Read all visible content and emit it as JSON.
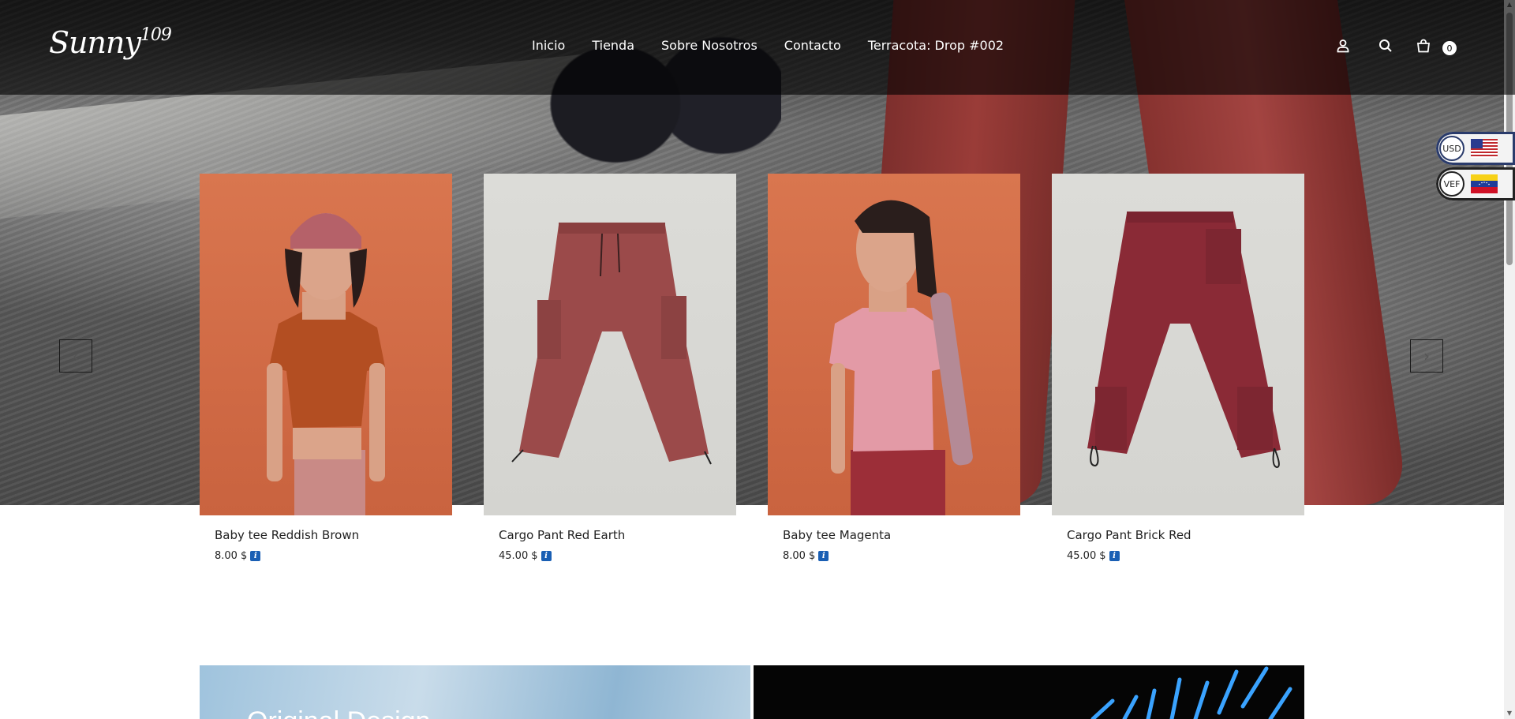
{
  "brand": {
    "logo_text": "Sunny",
    "logo_sup": "109"
  },
  "nav": {
    "items": [
      {
        "label": "Inicio"
      },
      {
        "label": "Tienda"
      },
      {
        "label": "Sobre Nosotros"
      },
      {
        "label": "Contacto"
      },
      {
        "label": "Terracota: Drop #002"
      }
    ]
  },
  "header_icons": {
    "account": "user-icon",
    "search": "search-icon",
    "cart": "shopping-bag-icon",
    "cart_count": "0"
  },
  "currency": {
    "usd": {
      "code": "USD",
      "flag": "us-flag-icon"
    },
    "vef": {
      "code": "VEF",
      "flag": "venezuela-flag-icon"
    }
  },
  "carousel": {
    "prev": "chevron-left-icon",
    "next": "chevron-right-icon"
  },
  "products": [
    {
      "name": "Baby tee Reddish Brown",
      "price": "8.00",
      "currency_symbol": "$",
      "color": "#b8532a"
    },
    {
      "name": "Cargo Pant Red Earth",
      "price": "45.00",
      "currency_symbol": "$",
      "color": "#9b4a4a"
    },
    {
      "name": "Baby tee Magenta",
      "price": "8.00",
      "currency_symbol": "$",
      "color": "#d98a9a"
    },
    {
      "name": "Cargo Pant Brick Red",
      "price": "45.00",
      "currency_symbol": "$",
      "color": "#8a2a36"
    }
  ],
  "banners": {
    "left_title": "Original Design"
  },
  "colors": {
    "header_bg": "#000000",
    "info_blue": "#1a5fb4",
    "hero_pants": "#9a3c38"
  }
}
